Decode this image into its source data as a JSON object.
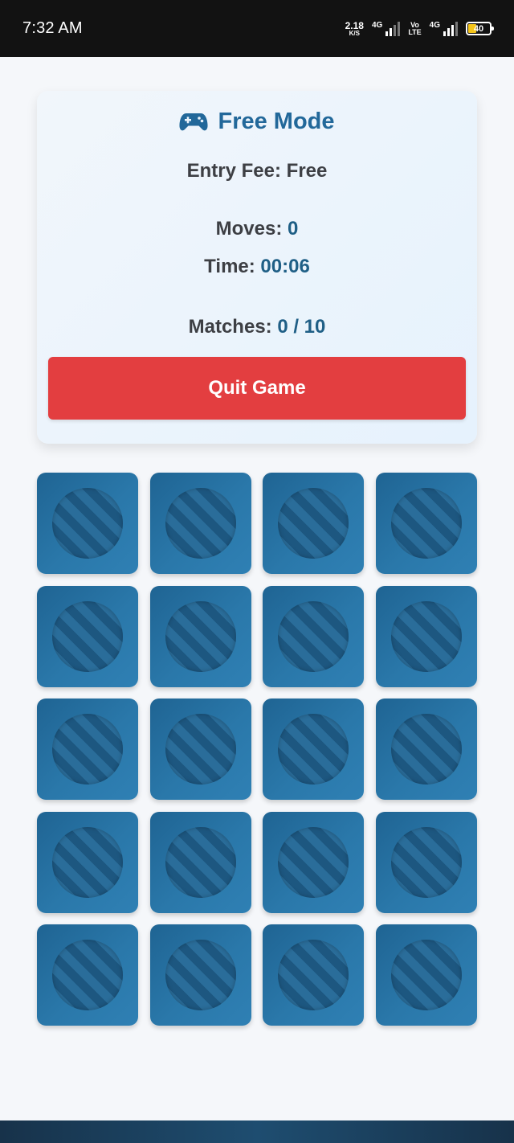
{
  "status_bar": {
    "time": "7:32 AM",
    "net_speed_value": "2.18",
    "net_speed_unit": "K/S",
    "sim1_label": "4G",
    "volte_top": "Vo",
    "volte_bottom": "LTE",
    "sim2_label": "4G",
    "battery_level": "40"
  },
  "game": {
    "mode_icon": "gamepad-icon",
    "mode_title": "Free Mode",
    "entry_fee_label": "Entry Fee: ",
    "entry_fee_value": "Free",
    "moves_label": "Moves: ",
    "moves_value": "0",
    "time_label": "Time: ",
    "time_value": "00:06",
    "matches_label": "Matches: ",
    "matches_value": "0 / 10",
    "quit_label": "Quit Game"
  },
  "board": {
    "columns": 4,
    "rows": 5,
    "cards_face_down": 20
  },
  "colors": {
    "accent": "#22689a",
    "quit_button": "#e33e40",
    "card_back": "#2a78aa"
  }
}
